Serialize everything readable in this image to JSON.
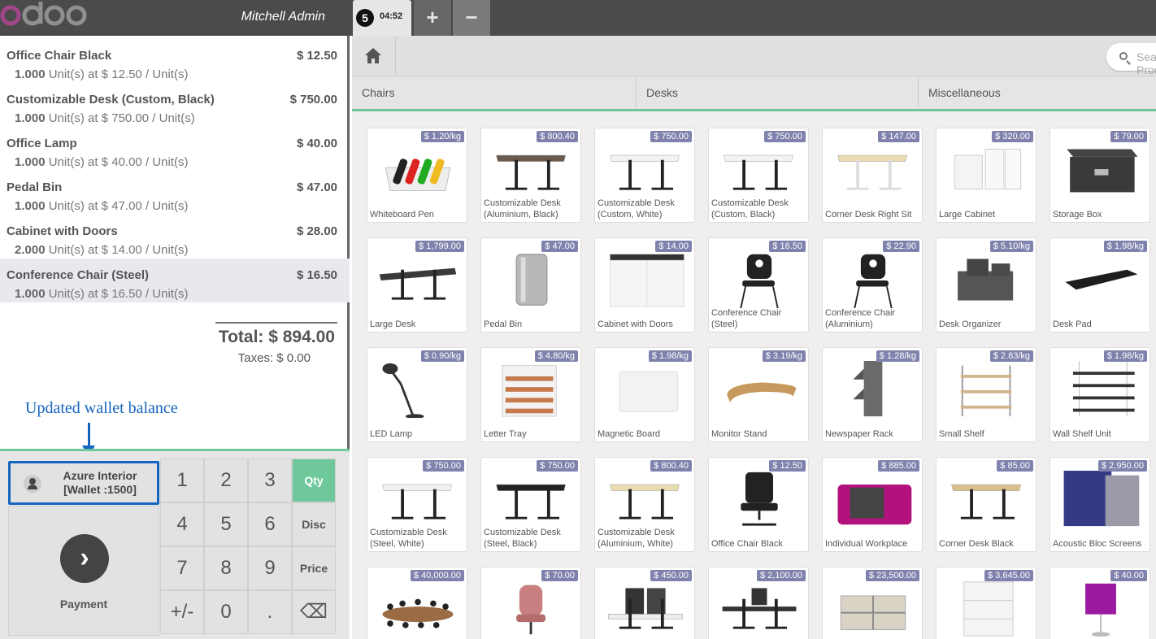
{
  "header": {
    "logo": "odoo",
    "user": "Mitchell Admin",
    "order": {
      "number": "5",
      "time": "04:52"
    },
    "add_label": "+",
    "remove_label": "−"
  },
  "order_lines": [
    {
      "name": "Office Chair Black",
      "price": "$ 12.50",
      "qty": "1.000",
      "detail": " Unit(s) at $ 12.50 / Unit(s)"
    },
    {
      "name": "Customizable Desk (Custom, Black)",
      "price": "$ 750.00",
      "qty": "1.000",
      "detail": " Unit(s) at $ 750.00 / Unit(s)"
    },
    {
      "name": "Office Lamp",
      "price": "$ 40.00",
      "qty": "1.000",
      "detail": " Unit(s) at $ 40.00 / Unit(s)"
    },
    {
      "name": "Pedal Bin",
      "price": "$ 47.00",
      "qty": "1.000",
      "detail": " Unit(s) at $ 47.00 / Unit(s)"
    },
    {
      "name": "Cabinet with Doors",
      "price": "$ 28.00",
      "qty": "2.000",
      "detail": " Unit(s) at $ 14.00 / Unit(s)"
    },
    {
      "name": "Conference Chair (Steel)",
      "price": "$ 16.50",
      "qty": "1.000",
      "detail": " Unit(s) at $ 16.50 / Unit(s)",
      "selected": true
    }
  ],
  "summary": {
    "total": "Total: $ 894.00",
    "taxes": "Taxes: $ 0.00"
  },
  "annotation": "Updated wallet balance",
  "pad": {
    "customer": "Azure Interior [Wallet :1500]",
    "payment_label": "Payment",
    "payment_icon": "chevron-right-icon",
    "keys": [
      [
        "1",
        "2",
        "3",
        "Qty"
      ],
      [
        "4",
        "5",
        "6",
        "Disc"
      ],
      [
        "7",
        "8",
        "9",
        "Price"
      ],
      [
        "+/-",
        "0",
        ".",
        "⌫"
      ]
    ],
    "active_mode": "Qty"
  },
  "search": {
    "placeholder": "Search Products..."
  },
  "categories": [
    "Chairs",
    "Desks",
    "Miscellaneous"
  ],
  "products": [
    {
      "name": "Whiteboard Pen",
      "price": "$ 1.20/kg",
      "type": "pen"
    },
    {
      "name": "Customizable Desk (Aluminium, Black)",
      "price": "$ 800.40",
      "type": "desk",
      "top": "#6b5a4e"
    },
    {
      "name": "Customizable Desk (Custom, White)",
      "price": "$ 750.00",
      "type": "desk",
      "top": "#f2f2f2"
    },
    {
      "name": "Customizable Desk (Custom, Black)",
      "price": "$ 750.00",
      "type": "desk",
      "top": "#f2f2f2"
    },
    {
      "name": "Corner Desk Right Sit",
      "price": "$ 147.00",
      "type": "desk-light",
      "top": "#e8dcb0"
    },
    {
      "name": "Large Cabinet",
      "price": "$ 320.00",
      "type": "cabinet"
    },
    {
      "name": "Storage Box",
      "price": "$ 79.00",
      "type": "box"
    },
    {
      "name": "Large Desk",
      "price": "$ 1,799.00",
      "type": "desk-wide",
      "top": "#3a3a3a"
    },
    {
      "name": "Pedal Bin",
      "price": "$ 47.00",
      "type": "bin"
    },
    {
      "name": "Cabinet with Doors",
      "price": "$ 14.00",
      "type": "cabinet-doors"
    },
    {
      "name": "Conference Chair (Steel)",
      "price": "$ 16.50",
      "type": "chair"
    },
    {
      "name": "Conference Chair (Aluminium)",
      "price": "$ 22.90",
      "type": "chair"
    },
    {
      "name": "Desk Organizer",
      "price": "$ 5.10/kg",
      "type": "organizer"
    },
    {
      "name": "Desk Pad",
      "price": "$ 1.98/kg",
      "type": "pad"
    },
    {
      "name": "LED Lamp",
      "price": "$ 0.90/kg",
      "type": "lamp"
    },
    {
      "name": "Letter Tray",
      "price": "$ 4.80/kg",
      "type": "tray"
    },
    {
      "name": "Magnetic Board",
      "price": "$ 1.98/kg",
      "type": "board"
    },
    {
      "name": "Monitor Stand",
      "price": "$ 3.19/kg",
      "type": "stand"
    },
    {
      "name": "Newspaper Rack",
      "price": "$ 1.28/kg",
      "type": "rack"
    },
    {
      "name": "Small Shelf",
      "price": "$ 2.83/kg",
      "type": "shelf"
    },
    {
      "name": "Wall Shelf Unit",
      "price": "$ 1.98/kg",
      "type": "wall-shelf"
    },
    {
      "name": "Customizable Desk (Steel, White)",
      "price": "$ 750.00",
      "type": "desk",
      "top": "#f2f2f2"
    },
    {
      "name": "Customizable Desk (Steel, Black)",
      "price": "$ 750.00",
      "type": "desk",
      "top": "#222222"
    },
    {
      "name": "Customizable Desk (Aluminium, White)",
      "price": "$ 800.40",
      "type": "desk",
      "top": "#e8dcb0"
    },
    {
      "name": "Office Chair Black",
      "price": "$ 12.50",
      "type": "office-chair"
    },
    {
      "name": "Individual Workplace",
      "price": "$ 885.00",
      "type": "workplace"
    },
    {
      "name": "Corner Desk Black",
      "price": "$ 85.00",
      "type": "desk",
      "top": "#d9bf8c"
    },
    {
      "name": "Acoustic Bloc Screens",
      "price": "$ 2,950.00",
      "type": "screens"
    },
    {
      "name": "",
      "price": "$ 40,000.00",
      "type": "conference"
    },
    {
      "name": "",
      "price": "$ 70.00",
      "type": "pink-chair"
    },
    {
      "name": "",
      "price": "$ 450.00",
      "type": "desk-screens"
    },
    {
      "name": "",
      "price": "$ 2,100.00",
      "type": "desk-dark"
    },
    {
      "name": "",
      "price": "$ 23,500.00",
      "type": "workstations"
    },
    {
      "name": "",
      "price": "$ 3,645.00",
      "type": "drawers"
    },
    {
      "name": "",
      "price": "$ 40.00",
      "type": "purple-lamp"
    }
  ],
  "colors": {
    "accent": "#6ec89b",
    "price_badge": "#7f82ac",
    "annotation": "#1565c0",
    "topbar": "#4b4b4b"
  }
}
